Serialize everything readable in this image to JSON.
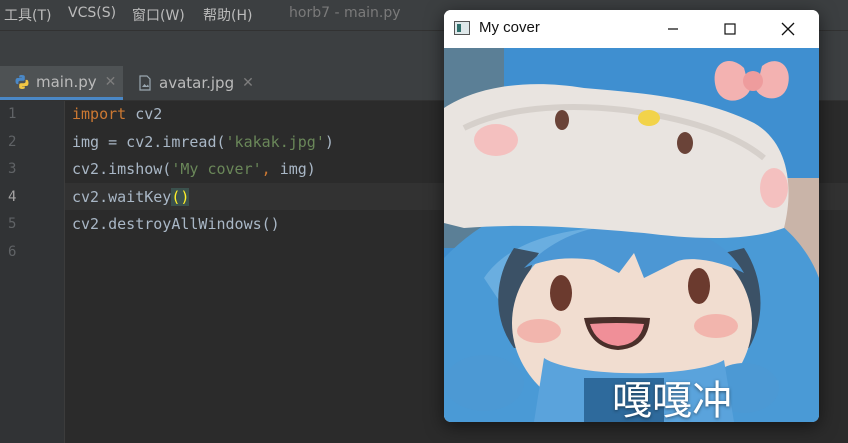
{
  "menubar": {
    "items": [
      "工具(T)",
      "VCS(S)",
      "窗口(W)",
      "帮助(H)"
    ],
    "title": "horb7 - main.py"
  },
  "tabs": [
    {
      "label": "main.py",
      "icon": "python-file-icon",
      "active": true
    },
    {
      "label": "avatar.jpg",
      "icon": "image-file-icon",
      "active": false
    }
  ],
  "editor": {
    "line_numbers": [
      "1",
      "2",
      "3",
      "4",
      "5",
      "6"
    ],
    "current_line": "4",
    "lines": {
      "l1_kw": "import",
      "l1_rest": " cv2",
      "l2_pre": "img = cv2.imread(",
      "l2_str": "'kakak.jpg'",
      "l2_post": ")",
      "l3_pre": "cv2.imshow(",
      "l3_str": "'My cover'",
      "l3_comma": ",",
      "l3_post": " img)",
      "l4_pre": "cv2.waitKey",
      "l4_paren": "()",
      "l5": "cv2.destroyAllWindows()"
    },
    "colors": {
      "keyword": "#cc7832",
      "string": "#6a8759",
      "text": "#a9b7c6",
      "background": "#2b2b2b"
    }
  },
  "cv_window": {
    "title": "My cover",
    "caption": "嘎嘎冲",
    "controls": [
      "minimize-icon",
      "maximize-icon",
      "close-icon"
    ]
  }
}
